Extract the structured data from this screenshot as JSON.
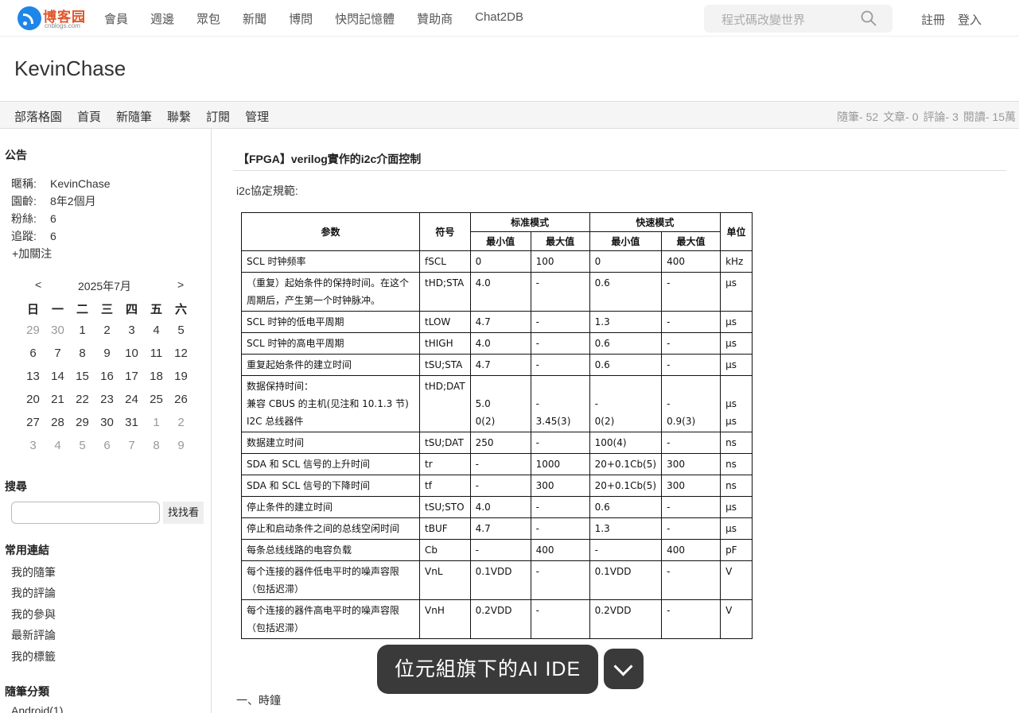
{
  "logo": {
    "text": "博客园",
    "subtext": "cnblogs.com"
  },
  "topnav": {
    "items": [
      "會員",
      "週邊",
      "眾包",
      "新聞",
      "博問",
      "快閃記憶體",
      "贊助商",
      "Chat2DB"
    ]
  },
  "search": {
    "placeholder": "程式碼改變世界"
  },
  "auth": {
    "register": "註冊",
    "login": "登入"
  },
  "blog_title": "KevinChase",
  "subnav": {
    "links": [
      "部落格園",
      "首頁",
      "新隨筆",
      "聯繫",
      "訂閱",
      "管理"
    ],
    "stats": [
      "隨筆- 52",
      "文章- 0",
      "評論- 3",
      "閱讀- 15萬"
    ]
  },
  "sidebar": {
    "notice_title": "公告",
    "profile": [
      {
        "k": "暱稱:",
        "v": "KevinChase"
      },
      {
        "k": "園齡:",
        "v": "8年2個月"
      },
      {
        "k": "粉絲:",
        "v": "6"
      },
      {
        "k": "追蹤:",
        "v": "6"
      }
    ],
    "follow": "+加關注",
    "calendar": {
      "prev": "<",
      "next": ">",
      "month": "2025年7月",
      "weekdays": [
        "日",
        "一",
        "二",
        "三",
        "四",
        "五",
        "六"
      ],
      "weeks": [
        [
          "29",
          "30",
          "1",
          "2",
          "3",
          "4",
          "5"
        ],
        [
          "6",
          "7",
          "8",
          "9",
          "10",
          "11",
          "12"
        ],
        [
          "13",
          "14",
          "15",
          "16",
          "17",
          "18",
          "19"
        ],
        [
          "20",
          "21",
          "22",
          "23",
          "24",
          "25",
          "26"
        ],
        [
          "27",
          "28",
          "29",
          "30",
          "31",
          "1",
          "2"
        ],
        [
          "3",
          "4",
          "5",
          "6",
          "7",
          "8",
          "9"
        ]
      ]
    },
    "search_title": "搜尋",
    "search_button": "找找看",
    "links_title": "常用連結",
    "links": [
      "我的隨筆",
      "我的評論",
      "我的參與",
      "最新評論",
      "我的標籤"
    ],
    "category_title": "隨筆分類",
    "categories": [
      "Android(1)"
    ]
  },
  "post": {
    "title": "【FPGA】verilog實作的i2c介面控制",
    "intro": "i2c協定規範:",
    "section1": "一、時鐘"
  },
  "spec_table": {
    "h": {
      "param": "参数",
      "symbol": "符号",
      "standard": "标准模式",
      "fast": "快速模式",
      "unit": "单位",
      "min": "最小值",
      "max": "最大值"
    },
    "rows": [
      {
        "param": "SCL 时钟频率",
        "sym": "fSCL",
        "smin": "0",
        "smax": "100",
        "fmin": "0",
        "fmax": "400",
        "unit": "kHz"
      },
      {
        "param": "（重复）起始条件的保持时间。在这个周期后，产生第一个时钟脉冲。",
        "sym": "tHD;STA",
        "smin": "4.0",
        "smax": "-",
        "fmin": "0.6",
        "fmax": "-",
        "unit": "μs"
      },
      {
        "param": "SCL 时钟的低电平周期",
        "sym": "tLOW",
        "smin": "4.7",
        "smax": "-",
        "fmin": "1.3",
        "fmax": "-",
        "unit": "μs"
      },
      {
        "param": "SCL 时钟的高电平周期",
        "sym": "tHIGH",
        "smin": "4.0",
        "smax": "-",
        "fmin": "0.6",
        "fmax": "-",
        "unit": "μs"
      },
      {
        "param": "重复起始条件的建立时间",
        "sym": "tSU;STA",
        "smin": "4.7",
        "smax": "-",
        "fmin": "0.6",
        "fmax": "-",
        "unit": "μs"
      },
      {
        "param": "数据保持时间：\n兼容 CBUS 的主机(见注和 10.1.3 节)\nI2C 总线器件",
        "sym": "tHD;DAT",
        "smin": "\n5.0\n0(2)",
        "smax": "\n-\n3.45(3)",
        "fmin": "\n-\n0(2)",
        "fmax": "\n-\n0.9(3)",
        "unit": "\nμs\nμs"
      },
      {
        "param": "数据建立时间",
        "sym": "tSU;DAT",
        "smin": "250",
        "smax": "-",
        "fmin": "100(4)",
        "fmax": "-",
        "unit": "ns"
      },
      {
        "param": "SDA 和 SCL 信号的上升时间",
        "sym": "tr",
        "smin": "-",
        "smax": "1000",
        "fmin": "20+0.1Cb(5)",
        "fmax": "300",
        "unit": "ns"
      },
      {
        "param": "SDA 和 SCL 信号的下降时间",
        "sym": "tf",
        "smin": "-",
        "smax": "300",
        "fmin": "20+0.1Cb(5)",
        "fmax": "300",
        "unit": "ns"
      },
      {
        "param": "停止条件的建立时间",
        "sym": "tSU;STO",
        "smin": "4.0",
        "smax": "-",
        "fmin": "0.6",
        "fmax": "-",
        "unit": "μs"
      },
      {
        "param": "停止和启动条件之间的总线空闲时间",
        "sym": "tBUF",
        "smin": "4.7",
        "smax": "-",
        "fmin": "1.3",
        "fmax": "-",
        "unit": "μs"
      },
      {
        "param": "每条总线线路的电容负载",
        "sym": "Cb",
        "smin": "-",
        "smax": "400",
        "fmin": "-",
        "fmax": "400",
        "unit": "pF"
      },
      {
        "param": "每个连接的器件低电平时的噪声容限（包括迟滞）",
        "sym": "VnL",
        "smin": "0.1VDD",
        "smax": "-",
        "fmin": "0.1VDD",
        "fmax": "-",
        "unit": "V"
      },
      {
        "param": "每个连接的器件高电平时的噪声容限（包括迟滞）",
        "sym": "VnH",
        "smin": "0.2VDD",
        "smax": "-",
        "fmin": "0.2VDD",
        "fmax": "-",
        "unit": "V"
      }
    ]
  },
  "banner": {
    "text": "位元組旗下的AI IDE"
  },
  "colors": {
    "logo_blue": "#1e86e8",
    "logo_orange": "#e1572a",
    "banner_bg": "#3a3a3a",
    "subnav_bg": "#f5f5f5"
  },
  "icons": {
    "search": "search-icon",
    "collapse": "chevron-down-icon",
    "logo": "logo-icon"
  }
}
